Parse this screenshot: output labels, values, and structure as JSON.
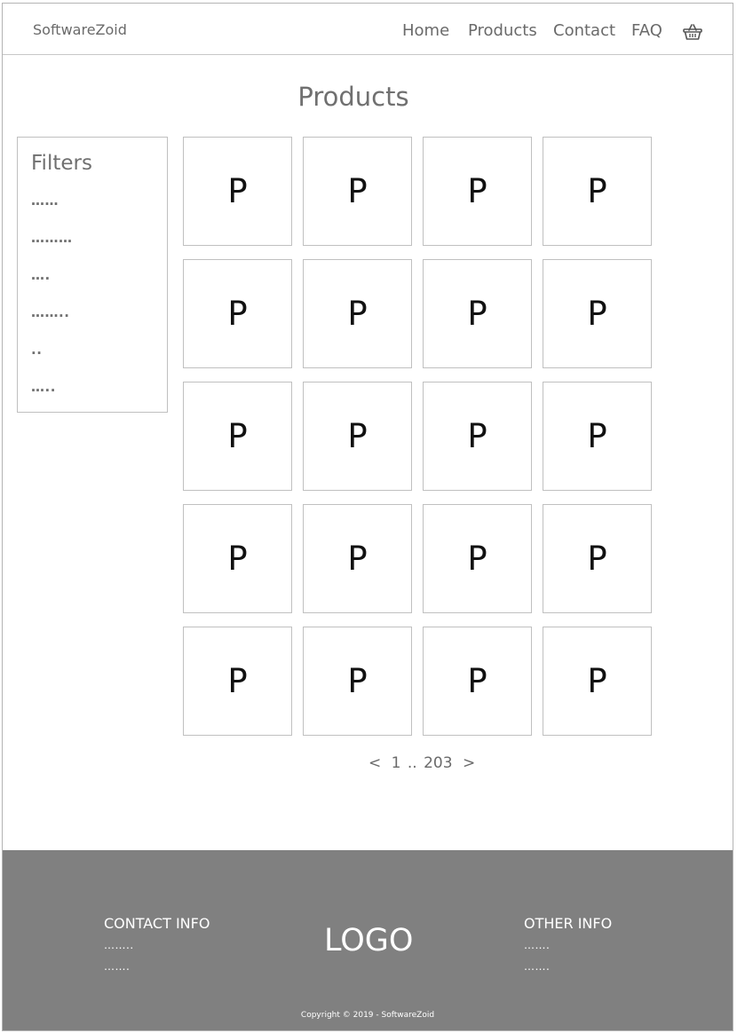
{
  "header": {
    "brand": "SoftwareZoid",
    "nav": [
      "Home",
      "Products",
      "Contact",
      "FAQ"
    ],
    "cart_icon": "basket-icon"
  },
  "page": {
    "title": "Products"
  },
  "filters": {
    "title": "Filters",
    "items": [
      "……",
      "………",
      "….",
      "……..",
      "..",
      "….."
    ]
  },
  "products": {
    "placeholder": "P",
    "count": 20
  },
  "pagination": {
    "prev": "<",
    "first": "1",
    "ellipsis": "..",
    "last": "203",
    "next": ">"
  },
  "footer": {
    "contact_title": "CONTACT INFO",
    "contact_lines": [
      "……..",
      "……."
    ],
    "logo": "LOGO",
    "other_title": "OTHER INFO",
    "other_lines": [
      "…….",
      "……."
    ],
    "copyright": "Copyright © 2019 - SoftwareZoid"
  },
  "colors": {
    "footer_bg": "#808080",
    "text_gray": "#6a6a6a",
    "border": "#c0c0c0"
  }
}
